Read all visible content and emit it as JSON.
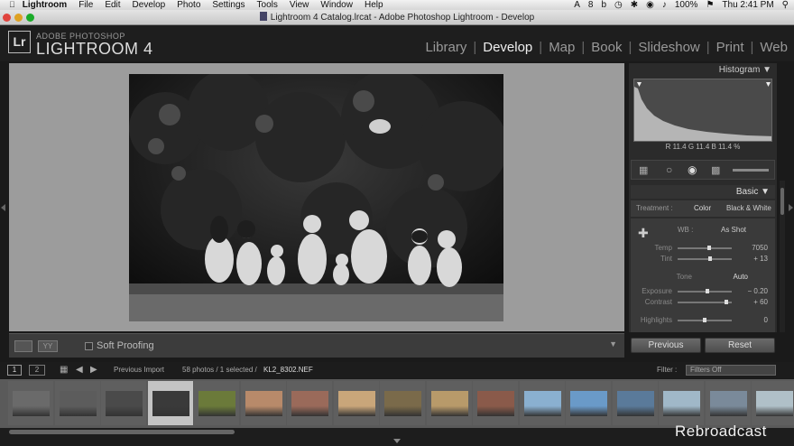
{
  "menubar": {
    "app": "Lightroom",
    "items": [
      "File",
      "Edit",
      "Develop",
      "Photo",
      "Settings",
      "Tools",
      "View",
      "Window",
      "Help"
    ],
    "battery": "100%",
    "clock": "Thu 2:41 PM",
    "status_number": "8"
  },
  "window": {
    "title": "Lightroom 4 Catalog.lrcat - Adobe Photoshop Lightroom - Develop"
  },
  "header": {
    "logo": "Lr",
    "brand_small": "ADOBE PHOTOSHOP",
    "brand_big": "LIGHTROOM 4",
    "modules": [
      "Library",
      "Develop",
      "Map",
      "Book",
      "Slideshow",
      "Print",
      "Web"
    ],
    "active_module": "Develop"
  },
  "toolbar": {
    "soft_proofing": "Soft Proofing"
  },
  "right_panel": {
    "histogram_label": "Histogram",
    "hist_values": "R 11.4  G 11.4  B 11.4 %",
    "basic_label": "Basic",
    "treatment_label": "Treatment :",
    "treatment_color": "Color",
    "treatment_bw": "Black & White",
    "wb_label": "WB :",
    "wb_value": "As Shot",
    "sliders": [
      {
        "label": "Temp",
        "value": "7050",
        "pos": 0.58
      },
      {
        "label": "Tint",
        "value": "+ 13",
        "pos": 0.6
      },
      {
        "label": "Tone",
        "value": "Auto",
        "pos": null
      },
      {
        "label": "Exposure",
        "value": "− 0.20",
        "pos": 0.55
      },
      {
        "label": "Contrast",
        "value": "+ 60",
        "pos": 0.9
      },
      {
        "label": "Highlights",
        "value": "0",
        "pos": 0.5
      }
    ],
    "previous": "Previous",
    "reset": "Reset"
  },
  "filmbar": {
    "page1": "1",
    "page2": "2",
    "source": "Previous Import",
    "count": "58 photos / 1 selected /",
    "filename": "KL2_8302.NEF",
    "filter_label": "Filter :",
    "filter_value": "Filters Off"
  },
  "filmstrip": {
    "selected_index": 3,
    "thumbs": [
      "#6a6a6a",
      "#5c5c5c",
      "#4a4a4a",
      "#3a3a3a",
      "#6b7a3a",
      "#b88a6a",
      "#9a6a5a",
      "#c9a67a",
      "#7a6a4a",
      "#b89a6a",
      "#8a5a4a",
      "#8ab0d0",
      "#6a9ac8",
      "#5a7a9a",
      "#a0b8c8",
      "#7a8a9a",
      "#b0c0c8"
    ]
  },
  "watermark": "Rebroadcast",
  "colors": {
    "accent": "#eeeeee",
    "panel": "#2b2b2b",
    "background": "#9c9c9c"
  }
}
